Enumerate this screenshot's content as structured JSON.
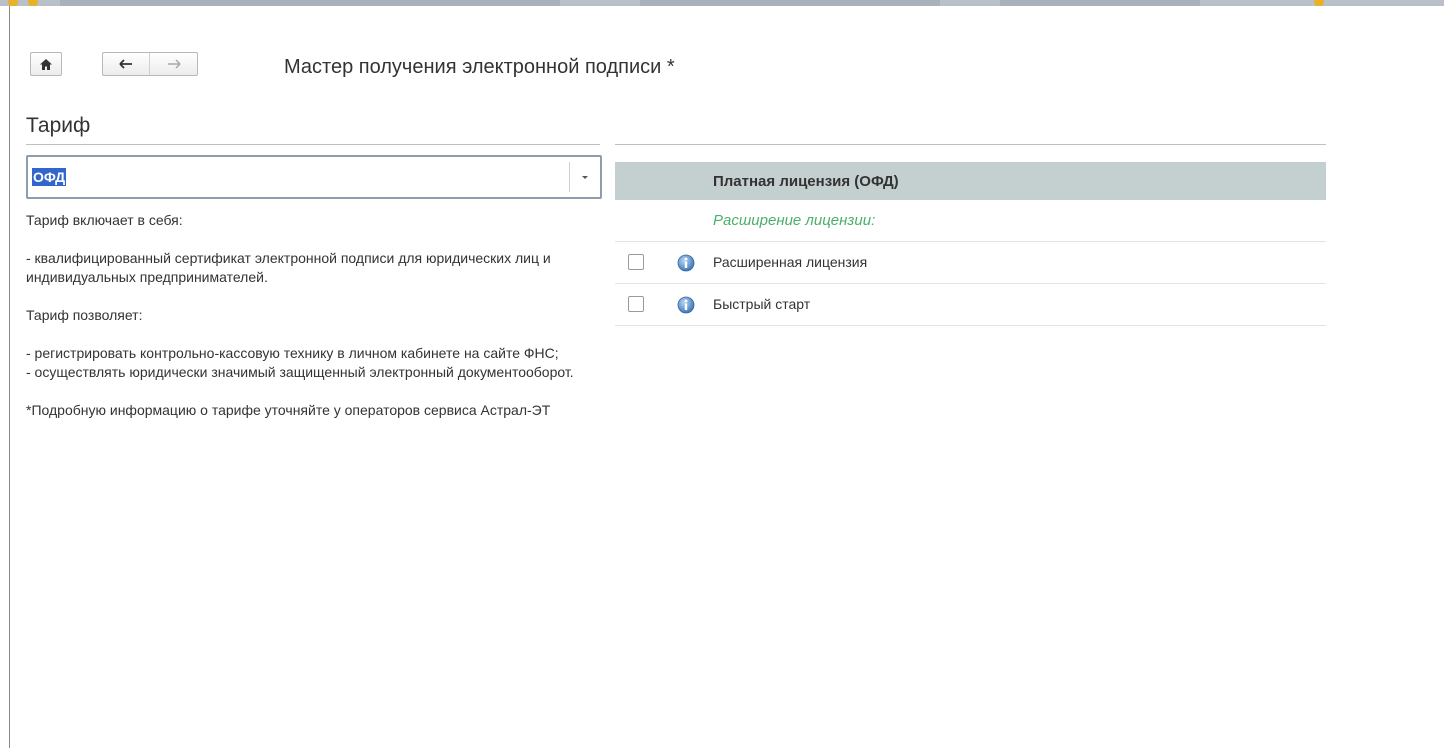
{
  "header": {
    "title": "Мастер получения электронной подписи *",
    "home_icon": "home-icon",
    "back_icon": "arrow-left-icon",
    "forward_icon": "arrow-right-icon"
  },
  "tariff": {
    "section_title": "Тариф",
    "selected_value": "ОФД",
    "dropdown_icon": "chevron-down-icon",
    "description": [
      "Тариф включает в себя:",
      "",
      "- квалифицированный сертификат электронной подписи для юридических лиц и индивидуальных предпринимателей.",
      "",
      "Тариф позволяет:",
      "",
      "- регистрировать контрольно-кассовую технику в личном кабинете на сайте ФНС;",
      "- осуществлять юридически значимый защищенный электронный документооборот.",
      "",
      "*Подробную информацию о тарифе уточняйте у операторов сервиса Астрал-ЭТ"
    ]
  },
  "license": {
    "header": "Платная лицензия (ОФД)",
    "subheader": "Расширение лицензии:",
    "options": [
      {
        "label": "Расширенная лицензия",
        "checked": false,
        "icon": "info-icon"
      },
      {
        "label": "Быстрый старт",
        "checked": false,
        "icon": "info-icon"
      }
    ]
  },
  "colors": {
    "accent": "#3366cc",
    "header_bg": "#c4d0d0",
    "subheader_text": "#4caf6a",
    "info_icon": "#4f86c6"
  }
}
